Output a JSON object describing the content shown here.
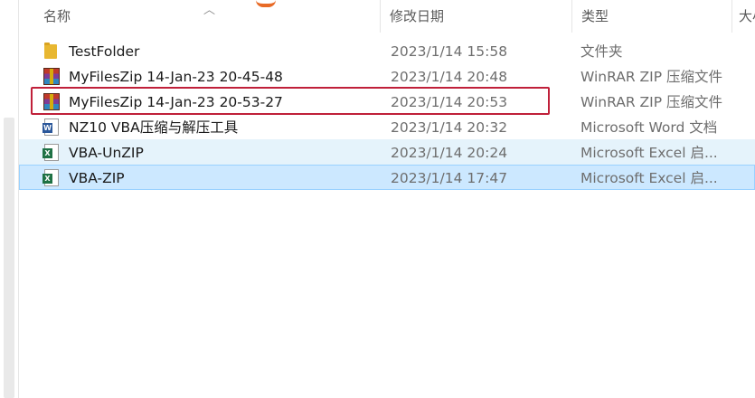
{
  "header": {
    "name": "名称",
    "date_modified": "修改日期",
    "type": "类型",
    "size": "大小"
  },
  "files": [
    {
      "name": "TestFolder",
      "date": "2023/1/14 15:58",
      "type": "文件夹",
      "icon": "folder-icon"
    },
    {
      "name": "MyFilesZip  14-Jan-23 20-45-48",
      "date": "2023/1/14 20:48",
      "type": "WinRAR ZIP 压缩文件",
      "icon": "winrar-icon"
    },
    {
      "name": "MyFilesZip  14-Jan-23 20-53-27",
      "date": "2023/1/14 20:53",
      "type": "WinRAR ZIP 压缩文件",
      "icon": "winrar-icon"
    },
    {
      "name": "NZ10 VBA压缩与解压工具",
      "date": "2023/1/14 20:32",
      "type": "Microsoft Word 文档",
      "icon": "word-icon"
    },
    {
      "name": "VBA-UnZIP",
      "date": "2023/1/14 20:24",
      "type": "Microsoft Excel 启...",
      "icon": "excel-icon"
    },
    {
      "name": "VBA-ZIP",
      "date": "2023/1/14 17:47",
      "type": "Microsoft Excel 启...",
      "icon": "excel-icon"
    }
  ],
  "colors": {
    "highlight_box": "#c0203a",
    "selected_row": "#cce8ff",
    "hover_row": "#e5f3fb"
  }
}
